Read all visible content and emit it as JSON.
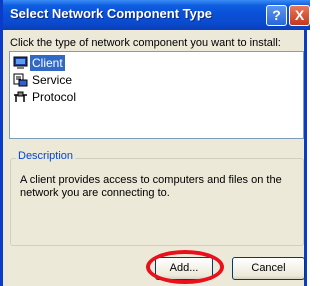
{
  "window": {
    "title": "Select Network Component Type",
    "help_glyph": "?",
    "close_glyph": "X"
  },
  "instruction": "Click the type of network component you want to install:",
  "components": [
    {
      "label": "Client",
      "icon": "client-icon",
      "selected": true
    },
    {
      "label": "Service",
      "icon": "service-icon",
      "selected": false
    },
    {
      "label": "Protocol",
      "icon": "protocol-icon",
      "selected": false
    }
  ],
  "description": {
    "legend": "Description",
    "text": "A client provides access to computers and files on the network you are connecting to."
  },
  "buttons": {
    "add": "Add...",
    "cancel": "Cancel"
  },
  "colors": {
    "titlebar": "#0a50d8",
    "selection": "#316ac5",
    "highlight": "#e8101a"
  }
}
